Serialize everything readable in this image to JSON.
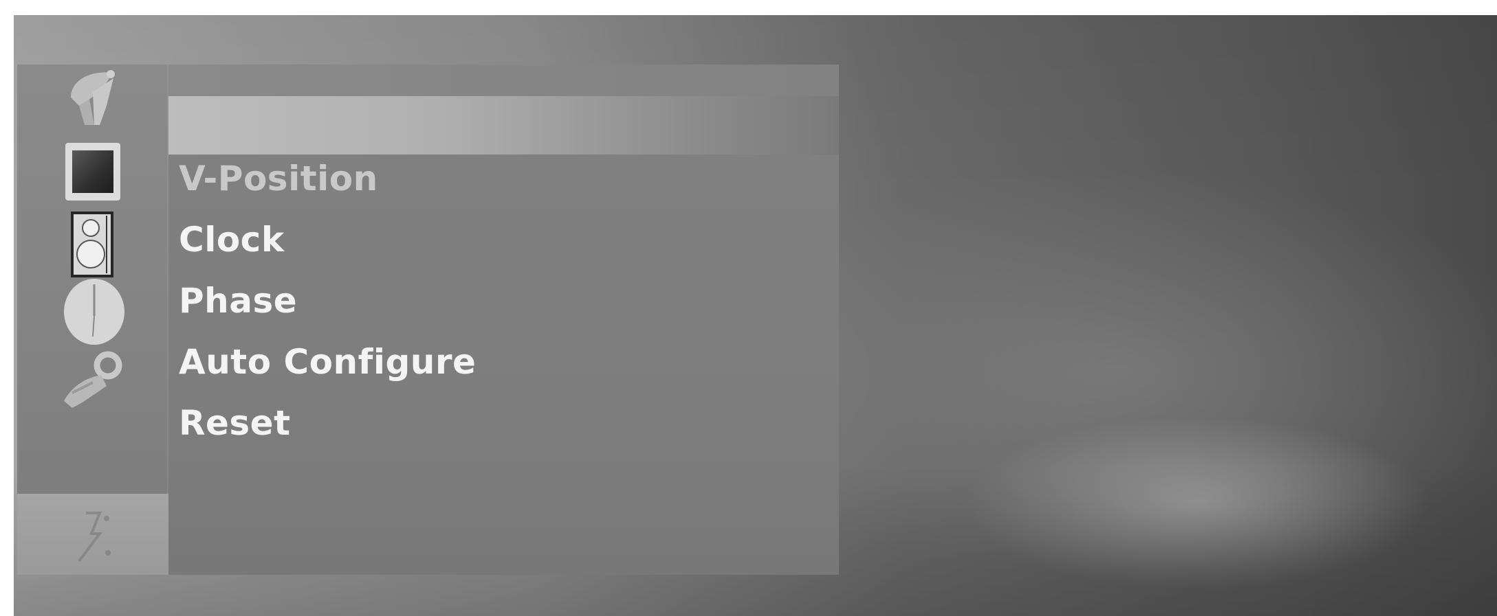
{
  "osd_menu": {
    "icons": [
      {
        "name": "satellite-dish-icon"
      },
      {
        "name": "picture-icon"
      },
      {
        "name": "audio-speaker-icon"
      },
      {
        "name": "time-clock-icon"
      },
      {
        "name": "special-key-icon"
      },
      {
        "name": "screen-adjust-icon"
      }
    ],
    "title": "",
    "selected_item": "",
    "items": [
      {
        "label": "V-Position",
        "state": "dim"
      },
      {
        "label": "Clock",
        "state": "bright"
      },
      {
        "label": "Phase",
        "state": "bright"
      },
      {
        "label": "Auto Configure",
        "state": "bright"
      },
      {
        "label": "Reset",
        "state": "bright"
      }
    ]
  },
  "colors": {
    "panel": "#7d7d7d",
    "highlight": "#bdbdbd",
    "text_bright": "#f4f4f4",
    "text_dim": "#c9c9c9"
  }
}
